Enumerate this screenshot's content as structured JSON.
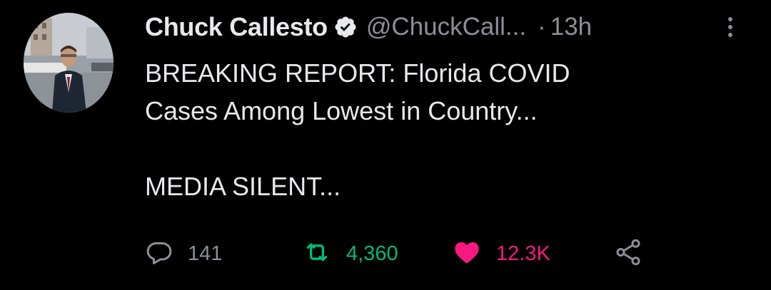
{
  "tweet": {
    "author": {
      "name": "Chuck Callesto",
      "verified": true,
      "handle": "@ChuckCall...",
      "avatar": "profile-photo"
    },
    "separator": "·",
    "timestamp": "13h",
    "text_lines": [
      "BREAKING REPORT: Florida COVID",
      "Cases Among Lowest in Country..."
    ],
    "text_line_after_break": "MEDIA SILENT...",
    "actions": {
      "reply": {
        "icon": "reply-bubble-icon",
        "count": "141",
        "color": "#8b9096"
      },
      "retweet": {
        "icon": "retweet-icon",
        "count": "4,360",
        "color": "#00ba7c",
        "active": true
      },
      "like": {
        "icon": "heart-icon",
        "count": "12.3K",
        "color": "#f91880",
        "active": true
      },
      "share": {
        "icon": "share-icon"
      }
    }
  },
  "colors": {
    "background": "#000000",
    "primary_text": "#e7e9ea",
    "secondary_text": "#8b9096",
    "verified_badge": "#e7e9ea"
  }
}
